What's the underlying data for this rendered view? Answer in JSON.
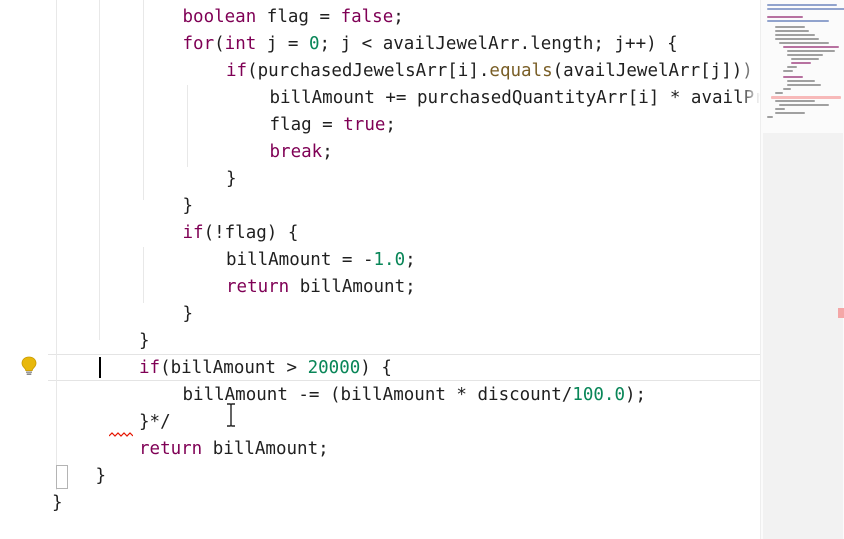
{
  "editor": {
    "lines": [
      {
        "id": "l1",
        "indent": 3,
        "tokens": [
          [
            "kw",
            "boolean"
          ],
          [
            "var",
            " flag = "
          ],
          [
            "kw",
            "false"
          ],
          [
            "var",
            ";"
          ]
        ]
      },
      {
        "id": "l2",
        "indent": 3,
        "tokens": [
          [
            "kw",
            "for"
          ],
          [
            "var",
            "("
          ],
          [
            "kw",
            "int"
          ],
          [
            "var",
            " j = "
          ],
          [
            "num",
            "0"
          ],
          [
            "var",
            "; j < availJewelArr.length; j++) {"
          ]
        ]
      },
      {
        "id": "l3",
        "indent": 4,
        "tokens": [
          [
            "kw",
            "if"
          ],
          [
            "var",
            "(purchasedJewelsArr[i]."
          ],
          [
            "fn",
            "equals"
          ],
          [
            "var",
            "(availJewelArr[j])) {"
          ]
        ]
      },
      {
        "id": "l4",
        "indent": 5,
        "tokens": [
          [
            "var",
            "billAmount += purchasedQuantityArr[i] * availPric"
          ]
        ]
      },
      {
        "id": "l5",
        "indent": 5,
        "tokens": [
          [
            "var",
            "flag = "
          ],
          [
            "kw",
            "true"
          ],
          [
            "var",
            ";"
          ]
        ]
      },
      {
        "id": "l6",
        "indent": 5,
        "tokens": [
          [
            "kw",
            "break"
          ],
          [
            "var",
            ";"
          ]
        ]
      },
      {
        "id": "l7",
        "indent": 4,
        "tokens": [
          [
            "var",
            "}"
          ]
        ]
      },
      {
        "id": "l8",
        "indent": 3,
        "tokens": [
          [
            "var",
            "}"
          ]
        ]
      },
      {
        "id": "l9",
        "indent": 3,
        "tokens": [
          [
            "kw",
            "if"
          ],
          [
            "var",
            "(!flag) {"
          ]
        ]
      },
      {
        "id": "l10",
        "indent": 4,
        "tokens": [
          [
            "var",
            "billAmount = -"
          ],
          [
            "num",
            "1.0"
          ],
          [
            "var",
            ";"
          ]
        ]
      },
      {
        "id": "l11",
        "indent": 4,
        "tokens": [
          [
            "kw",
            "return"
          ],
          [
            "var",
            " billAmount;"
          ]
        ]
      },
      {
        "id": "l12",
        "indent": 3,
        "tokens": [
          [
            "var",
            "}"
          ]
        ]
      },
      {
        "id": "l13",
        "indent": 2,
        "tokens": [
          [
            "var",
            "}"
          ]
        ]
      },
      {
        "id": "l14",
        "indent": 2,
        "tokens": [
          [
            "kw",
            "if"
          ],
          [
            "var",
            "(billAmount > "
          ],
          [
            "num",
            "20000"
          ],
          [
            "var",
            ") {"
          ]
        ]
      },
      {
        "id": "l15",
        "indent": 3,
        "tokens": [
          [
            "var",
            "billAmount -= (billAmount * discount/"
          ],
          [
            "num",
            "100.0"
          ],
          [
            "var",
            ");"
          ]
        ]
      },
      {
        "id": "l16",
        "indent": 2,
        "tokens": [
          [
            "var",
            "}*/"
          ]
        ]
      },
      {
        "id": "l17",
        "indent": 2,
        "tokens": [
          [
            "kw",
            "return"
          ],
          [
            "var",
            " billAmount;"
          ]
        ]
      },
      {
        "id": "l18",
        "indent": 1,
        "tokens": [
          [
            "var",
            "}"
          ]
        ]
      },
      {
        "id": "l19",
        "indent": 0,
        "tokens": [
          [
            "var",
            "}"
          ]
        ]
      }
    ]
  },
  "minimap": {
    "header_lines": [
      "package programming/jewelsSystem;",
      "//DO NOT MODIFY THE CODE PROVIDED TO YOU"
    ]
  },
  "colors": {
    "keyword": "#7f0055",
    "number": "#098658",
    "method": "#795e26",
    "text": "#1f1f1f"
  },
  "icons": [
    "lightbulb-icon",
    "text-cursor-icon",
    "error-squiggle"
  ]
}
